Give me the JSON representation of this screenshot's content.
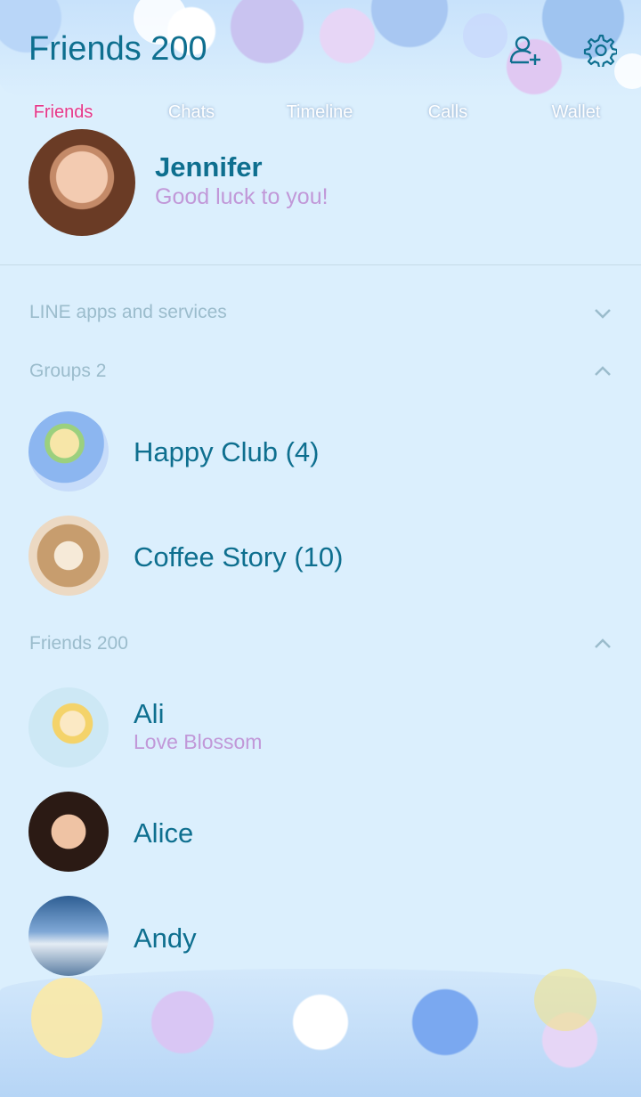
{
  "header": {
    "title": "Friends 200",
    "add_friend_icon": "add-friend-icon",
    "settings_icon": "gear-icon"
  },
  "profile": {
    "name": "Jennifer",
    "status": "Good luck to you!"
  },
  "sections": {
    "services": {
      "label": "LINE apps and services",
      "state": "collapsed"
    },
    "groups": {
      "label": "Groups 2",
      "state": "expanded"
    },
    "friends": {
      "label": "Friends 200",
      "state": "expanded"
    }
  },
  "groups": [
    {
      "name": "Happy Club (4)"
    },
    {
      "name": "Coffee Story (10)"
    }
  ],
  "friends": [
    {
      "name": "Ali",
      "status": "Love Blossom"
    },
    {
      "name": "Alice",
      "status": ""
    },
    {
      "name": "Andy",
      "status": ""
    }
  ],
  "tabs": [
    {
      "label": "Friends",
      "active": true
    },
    {
      "label": "Chats",
      "active": false
    },
    {
      "label": "Timeline",
      "active": false
    },
    {
      "label": "Calls",
      "active": false
    },
    {
      "label": "Wallet",
      "active": false
    }
  ],
  "colors": {
    "accent": "#0e6f8f",
    "status": "#c198d8",
    "active_tab": "#e6378a",
    "background": "#dbeffd"
  }
}
